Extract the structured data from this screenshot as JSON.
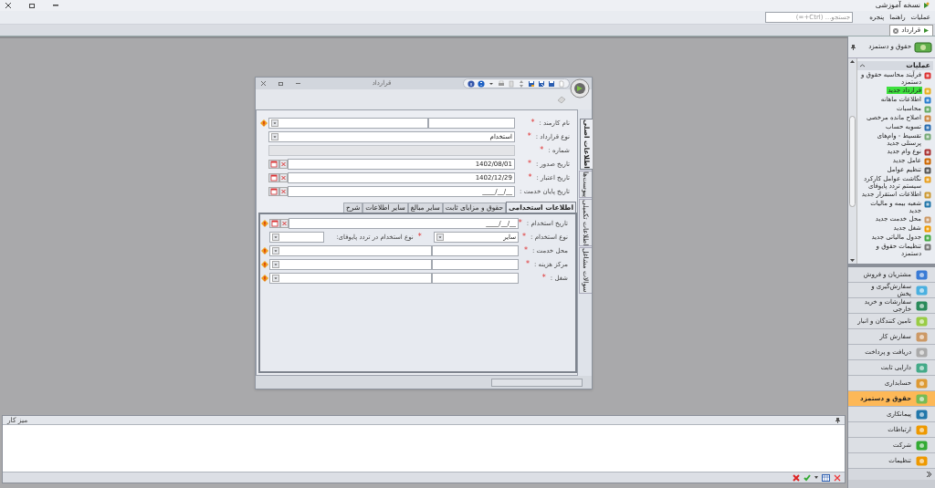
{
  "app_title": "نسخه آموزشی",
  "menu": [
    {
      "label": "عملیات"
    },
    {
      "label": "راهنما"
    },
    {
      "label": "پنجره"
    }
  ],
  "search": {
    "placeholder": "جستجو... (Ctrl+=)"
  },
  "doc_tabs": [
    {
      "label": "قرارداد",
      "selected": true
    }
  ],
  "dialog": {
    "title": "قرارداد",
    "side_tabs": [
      {
        "label": "اطلاعات اصلی",
        "selected": true
      },
      {
        "label": "پیوست‌ها",
        "selected": false
      },
      {
        "label": "اطلاعات تکمیلی",
        "selected": false
      },
      {
        "label": "سوالات مشاغل",
        "selected": false
      }
    ],
    "fields": [
      {
        "kind": "lookup",
        "label": "نام کارمند :",
        "required_mark": "*"
      },
      {
        "kind": "combo",
        "label": "نوع قرارداد :",
        "required_mark": "*",
        "value": "استخدام"
      },
      {
        "kind": "readonly",
        "label": "شماره :",
        "required_mark": "*"
      },
      {
        "kind": "date",
        "label": "تاریخ صدور :",
        "required_mark": "*",
        "value": "1402/08/01"
      },
      {
        "kind": "date",
        "label": "تاریخ اعتبار :",
        "required_mark": "*",
        "value": "1402/12/29"
      },
      {
        "kind": "date",
        "label": "تاریخ پایان خدمت :",
        "value": "____/__/__"
      }
    ],
    "inner_tabs": [
      {
        "label": "اطلاعات استخدامی",
        "selected": true
      },
      {
        "label": "حقوق و مزایای ثابت",
        "selected": false
      },
      {
        "label": "سایر مبالغ",
        "selected": false
      },
      {
        "label": "سایر اطلاعات",
        "selected": false
      },
      {
        "label": "شرح",
        "selected": false
      }
    ],
    "inner_fields": [
      {
        "kind": "date",
        "label": "تاریخ استخدام :",
        "required_mark": "*",
        "value": "____/__/__",
        "warning": true
      },
      {
        "kind": "combo_pair",
        "label": "نوع استخدام :",
        "required_mark": "*",
        "value": "سایر",
        "extra": {
          "label": "نوع استخدام در تردد پایوفای:",
          "required_mark": "*"
        }
      },
      {
        "kind": "lookup",
        "label": "محل خدمت :",
        "required_mark": "*"
      },
      {
        "kind": "lookup",
        "label": "مرکز هزینه :",
        "required_mark": "*"
      },
      {
        "kind": "lookup",
        "label": "شغل :",
        "required_mark": "*"
      }
    ]
  },
  "sidebar": {
    "title": "حقوق و دستمزد",
    "group_title": "عملیات",
    "items": [
      {
        "label": "فرآیند محاسبه حقوق و دستمزد",
        "selected": false
      },
      {
        "label": "قرارداد جدید",
        "selected": true
      },
      {
        "label": "اطلاعات ماهانه",
        "selected": false
      },
      {
        "label": "محاسبات",
        "selected": false
      },
      {
        "label": "اصلاح مانده مرخصی",
        "selected": false
      },
      {
        "label": "تسویه حساب",
        "selected": false
      },
      {
        "label": "تقسیط - وام‌های پرسنلی جدید",
        "selected": false
      },
      {
        "label": "نوع وام جدید",
        "selected": false
      },
      {
        "label": "عامل جدید",
        "selected": false
      },
      {
        "label": "تنظیم عوامل",
        "selected": false
      },
      {
        "label": "نگاشت عوامل کارکرد سیستم تردد پایوفای",
        "selected": false
      },
      {
        "label": "اطلاعات استقرار جدید",
        "selected": false
      },
      {
        "label": "شعبه بیمه و مالیات جدید",
        "selected": false
      },
      {
        "label": "محل خدمت جدید",
        "selected": false
      },
      {
        "label": "شغل جدید",
        "selected": false
      },
      {
        "label": "جدول مالیاتی جدید",
        "selected": false
      },
      {
        "label": "تنظیمات حقوق و دستمزد",
        "selected": false
      }
    ],
    "modules": [
      {
        "label": "مشتریان و فروش",
        "selected": false
      },
      {
        "label": "سفارش‌گیری و پخش",
        "selected": false
      },
      {
        "label": "سفارشات و خرید خارجی",
        "selected": false
      },
      {
        "label": "تامین کنندگان و انبار",
        "selected": false
      },
      {
        "label": "سفارش کار",
        "selected": false
      },
      {
        "label": "دریافت و پرداخت",
        "selected": false
      },
      {
        "label": "دارایی ثابت",
        "selected": false
      },
      {
        "label": "حسابداری",
        "selected": false
      },
      {
        "label": "حقوق و دستمزد",
        "selected": true
      },
      {
        "label": "پیمانکاری",
        "selected": false
      },
      {
        "label": "ارتباطات",
        "selected": false
      },
      {
        "label": "شرکت",
        "selected": false
      },
      {
        "label": "تنظیمات",
        "selected": false
      }
    ]
  },
  "workspace": {
    "title": "میز کار"
  }
}
